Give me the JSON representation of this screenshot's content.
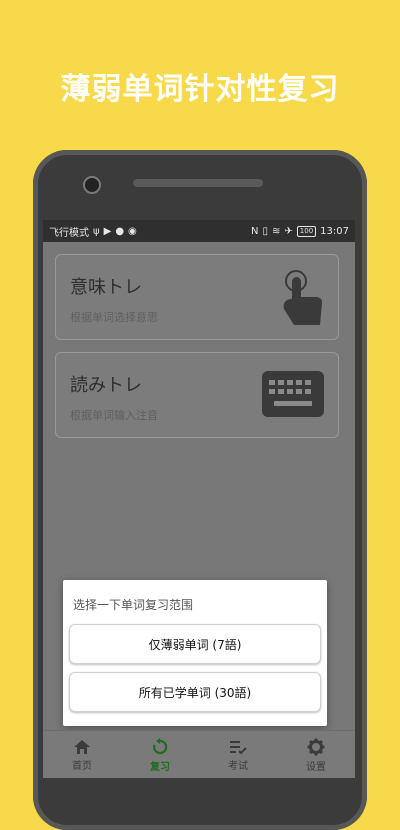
{
  "headline": "薄弱单词针对性复习",
  "status_bar": {
    "left_text": "飞行模式",
    "time": "13:07",
    "battery": "100"
  },
  "cards": [
    {
      "title": "意味トレ",
      "subtitle": "根据单词选择意思",
      "icon": "touch-hand-icon"
    },
    {
      "title": "読みトレ",
      "subtitle": "根据单词输入注音",
      "icon": "keyboard-icon"
    }
  ],
  "dialog": {
    "title": "选择一下单词复习范围",
    "options": [
      "仅薄弱单词 (7語)",
      "所有已学单词 (30語)"
    ]
  },
  "tabs": [
    {
      "label": "首页",
      "icon": "home-icon",
      "active": false
    },
    {
      "label": "复习",
      "icon": "review-refresh-icon",
      "active": true
    },
    {
      "label": "考试",
      "icon": "exam-list-check-icon",
      "active": false
    },
    {
      "label": "设置",
      "icon": "settings-gear-icon",
      "active": false
    }
  ],
  "colors": {
    "background": "#f7d94a",
    "active_tab": "#1f6b1f"
  }
}
